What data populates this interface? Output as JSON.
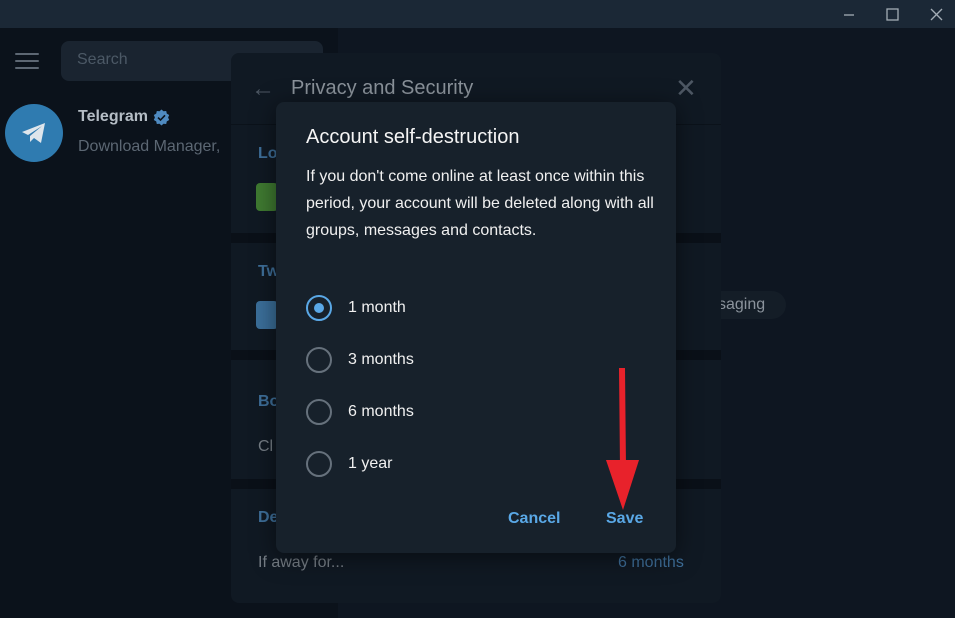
{
  "window": {
    "min_icon": "minimize-icon",
    "max_icon": "maximize-icon",
    "close_icon": "close-icon"
  },
  "sidebar": {
    "search_placeholder": "Search",
    "chats": [
      {
        "name": "Telegram",
        "preview": "Download Manager,",
        "verified": true
      }
    ]
  },
  "background": {
    "pill_text": "saging"
  },
  "privacy_panel": {
    "title": "Privacy and Security",
    "sections": [
      {
        "label": "Lo"
      },
      {
        "label": "Tw"
      },
      {
        "label": "Bo",
        "text": "Cl"
      },
      {
        "label": "De",
        "text": "If away for...",
        "value": "6 months"
      }
    ]
  },
  "dialog": {
    "title": "Account self-destruction",
    "description": "If you don't come online at least once within this period, your account will be deleted along with all groups, messages and contacts.",
    "options": [
      {
        "label": "1 month",
        "checked": true
      },
      {
        "label": "3 months",
        "checked": false
      },
      {
        "label": "6 months",
        "checked": false
      },
      {
        "label": "1 year",
        "checked": false
      }
    ],
    "cancel_label": "Cancel",
    "save_label": "Save"
  },
  "colors": {
    "accent": "#5aa8e6",
    "dialog_bg": "#17212b",
    "annotation": "#e8222b"
  }
}
